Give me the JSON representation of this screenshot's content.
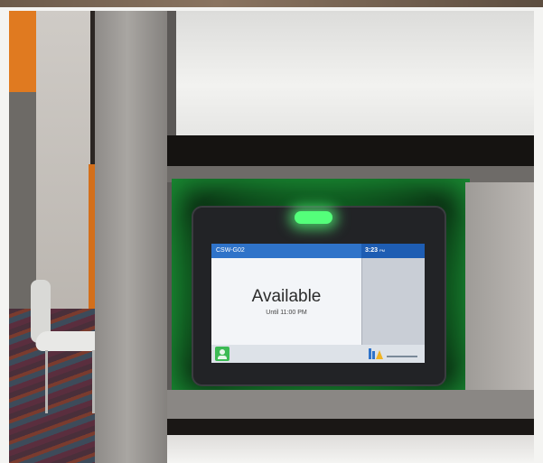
{
  "device": {
    "room_code": "CSW-G02",
    "clock_time": "3:23",
    "clock_suffix": "PM",
    "status": "Available",
    "until_text": "Until 11:00 PM"
  },
  "colors": {
    "header_blue": "#2f73c9",
    "status_led": "#54ff7a",
    "glow_green": "#1f8a36",
    "footer_icon": "#3cba54"
  },
  "icons": {
    "footer_left": "person-icon",
    "footer_right": "company-logo"
  }
}
